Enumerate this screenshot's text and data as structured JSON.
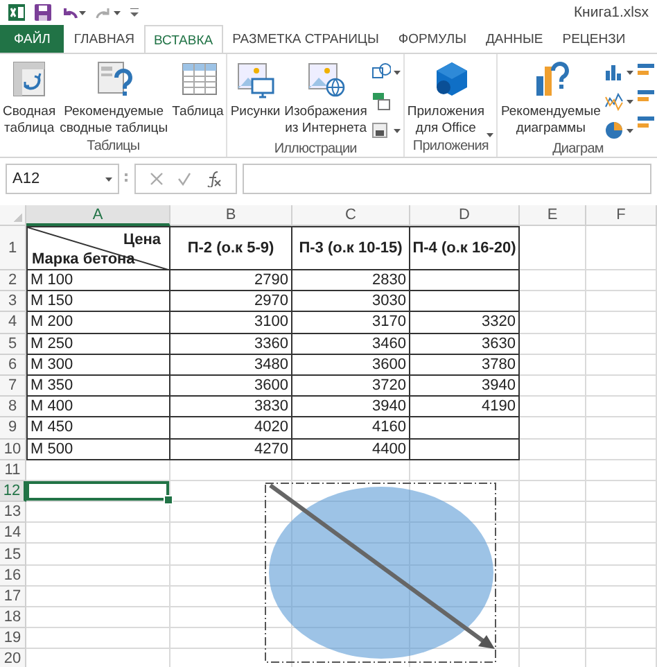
{
  "title_bar": {
    "file_name": "Книга1.xlsx"
  },
  "tabs": [
    {
      "label": "ФАЙЛ",
      "kind": "file",
      "selected": false
    },
    {
      "label": "ГЛАВНАЯ",
      "kind": "tab",
      "selected": false
    },
    {
      "label": "ВСТАВКА",
      "kind": "tab",
      "selected": true
    },
    {
      "label": "РАЗМЕТКА СТРАНИЦЫ",
      "kind": "tab",
      "selected": false
    },
    {
      "label": "ФОРМУЛЫ",
      "kind": "tab",
      "selected": false
    },
    {
      "label": "ДАННЫЕ",
      "kind": "tab",
      "selected": false
    },
    {
      "label": "РЕЦЕНЗИ",
      "kind": "tab",
      "selected": false
    }
  ],
  "ribbon": {
    "groups": [
      {
        "label": "Таблицы",
        "buttons": [
          {
            "kind": "large",
            "label": "Сводная\nтаблица",
            "dropdown": false
          },
          {
            "kind": "large",
            "label": "Рекомендуемые\nсводные таблицы",
            "dropdown": false
          },
          {
            "kind": "large",
            "label": "Таблица",
            "dropdown": false
          }
        ]
      },
      {
        "label": "Иллюстрации",
        "buttons": [
          {
            "kind": "large",
            "label": "Рисунки",
            "dropdown": false
          },
          {
            "kind": "large",
            "label": "Изображения\nиз Интернета",
            "dropdown": false
          },
          {
            "kind": "small",
            "dropdown": true
          },
          {
            "kind": "small",
            "dropdown": false
          },
          {
            "kind": "small",
            "dropdown": true
          }
        ]
      },
      {
        "label": "Приложения",
        "buttons": [
          {
            "kind": "large",
            "label": "Приложения\nдля Office",
            "dropdown": true
          }
        ]
      },
      {
        "label": "Диаграм",
        "buttons": [
          {
            "kind": "large",
            "label": "Рекомендуемые\nдиаграммы",
            "dropdown": false
          },
          {
            "kind": "small",
            "dropdown": true
          },
          {
            "kind": "small",
            "dropdown": true
          },
          {
            "kind": "small",
            "dropdown": true
          }
        ]
      }
    ]
  },
  "formula_bar": {
    "name_box": "A12"
  },
  "sheet": {
    "columns": [
      {
        "label": "A",
        "selected": true
      },
      {
        "label": "B",
        "selected": false
      },
      {
        "label": "C",
        "selected": false
      },
      {
        "label": "D",
        "selected": false
      },
      {
        "label": "E",
        "selected": false
      },
      {
        "label": "F",
        "selected": false
      }
    ],
    "rows": [
      {
        "number": "1",
        "kind": "header",
        "selected": false,
        "A_top": "Цена",
        "A_bottom": "Марка бетона",
        "B": "П-2 (о.к 5-9)",
        "C": "П-3 (о.к 10-15)",
        "D": "П-4 (о.к 16-20)"
      },
      {
        "number": "2",
        "kind": "data",
        "selected": false,
        "A": "М 100",
        "B": "2790",
        "C": "2830"
      },
      {
        "number": "3",
        "kind": "data",
        "selected": false,
        "A": "М 150",
        "B": "2970",
        "C": "3030"
      },
      {
        "number": "4",
        "kind": "data",
        "selected": false,
        "A": "М 200",
        "B": "3100",
        "C": "3170",
        "D": "3320"
      },
      {
        "number": "5",
        "kind": "data",
        "selected": false,
        "A": "М 250",
        "B": "3360",
        "C": "3460",
        "D": "3630"
      },
      {
        "number": "6",
        "kind": "data",
        "selected": false,
        "A": "М 300",
        "B": "3480",
        "C": "3600",
        "D": "3780"
      },
      {
        "number": "7",
        "kind": "data",
        "selected": false,
        "A": "М 350",
        "B": "3600",
        "C": "3720",
        "D": "3940"
      },
      {
        "number": "8",
        "kind": "data",
        "selected": false,
        "A": "М 400",
        "B": "3830",
        "C": "3940",
        "D": "4190"
      },
      {
        "number": "9",
        "kind": "data",
        "selected": false,
        "A": "М 450",
        "B": "4020",
        "C": "4160"
      },
      {
        "number": "10",
        "kind": "data",
        "selected": false,
        "A": "М 500",
        "B": "4270",
        "C": "4400"
      },
      {
        "number": "11",
        "kind": "empty",
        "selected": false
      },
      {
        "number": "12",
        "kind": "empty",
        "selected": true
      },
      {
        "number": "13",
        "kind": "empty",
        "selected": false
      },
      {
        "number": "14",
        "kind": "empty",
        "selected": false
      },
      {
        "number": "15",
        "kind": "empty",
        "selected": false
      },
      {
        "number": "16",
        "kind": "empty",
        "selected": false
      },
      {
        "number": "17",
        "kind": "empty",
        "selected": false
      },
      {
        "number": "18",
        "kind": "empty",
        "selected": false
      },
      {
        "number": "19",
        "kind": "empty",
        "selected": false
      },
      {
        "number": "20",
        "kind": "empty",
        "selected": false
      }
    ],
    "drawing": {
      "selected": true,
      "shapes": [
        {
          "kind": "ellipse"
        },
        {
          "kind": "arrow"
        }
      ]
    }
  }
}
